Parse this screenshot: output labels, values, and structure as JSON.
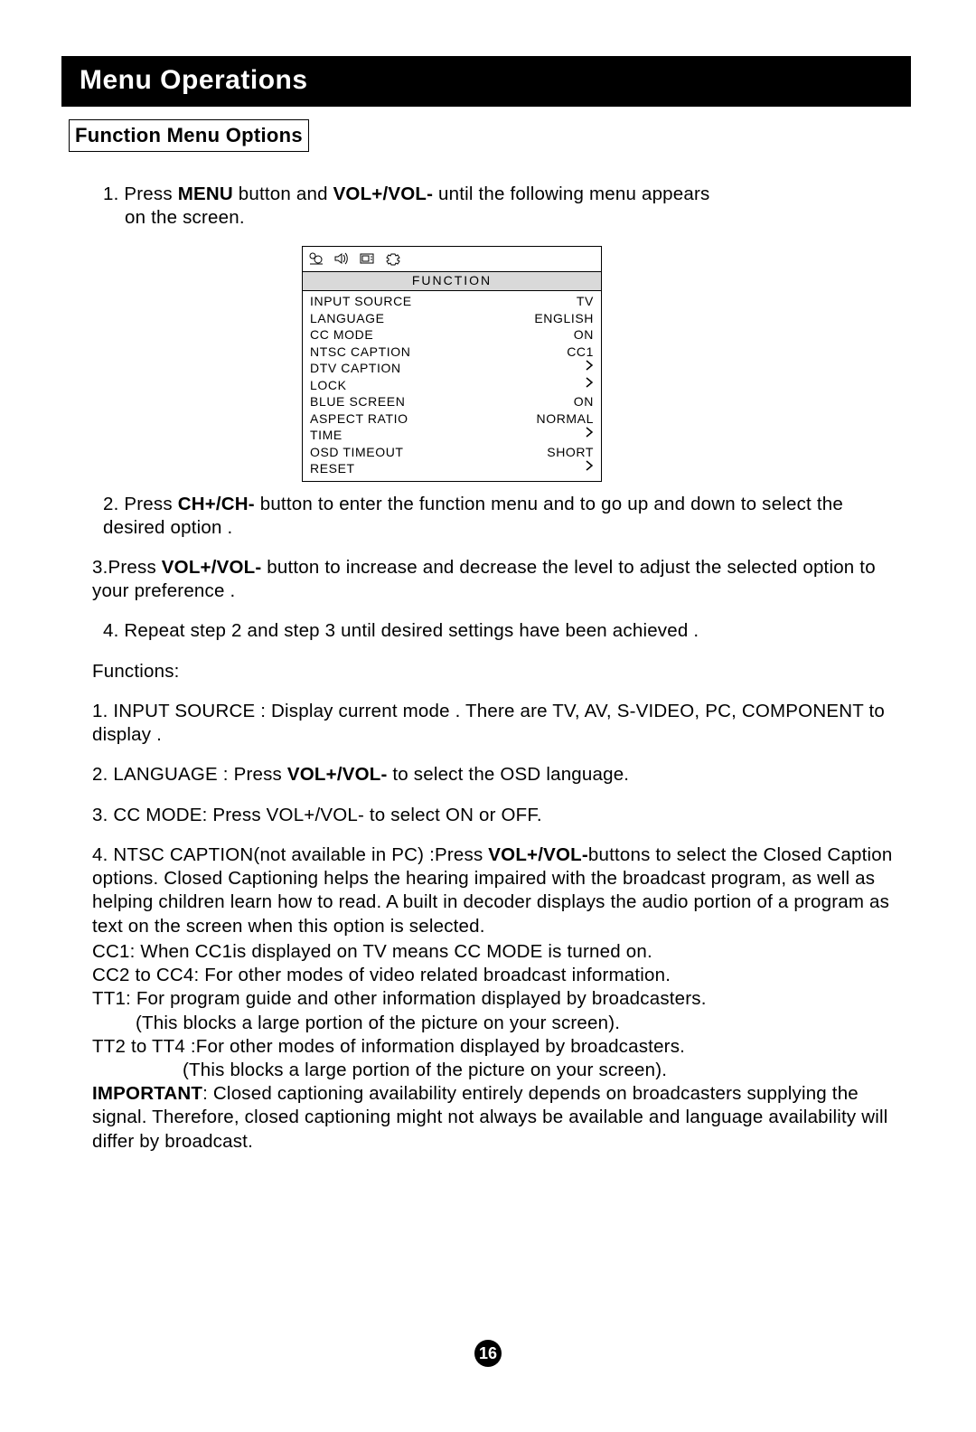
{
  "title": "Menu Operations",
  "subhead": "Function Menu Options",
  "step1_a": "1. Press ",
  "step1_b": "MENU",
  "step1_c": " button and ",
  "step1_d": "VOL+/VOL-",
  "step1_e": " until the following menu appears",
  "step1_f": "on the screen.",
  "menu": {
    "header": "FUNCTION",
    "rows": [
      {
        "label": "INPUT SOURCE",
        "value": "TV"
      },
      {
        "label": "LANGUAGE",
        "value": "ENGLISH"
      },
      {
        "label": "CC MODE",
        "value": "ON"
      },
      {
        "label": "NTSC CAPTION",
        "value": "CC1"
      },
      {
        "label": "DTV CAPTION",
        "value": "▶"
      },
      {
        "label": "LOCK",
        "value": "▶"
      },
      {
        "label": "BLUE SCREEN",
        "value": "ON"
      },
      {
        "label": "ASPECT RATIO",
        "value": "NORMAL"
      },
      {
        "label": "TIME",
        "value": "▶"
      },
      {
        "label": "OSD TIMEOUT",
        "value": "SHORT"
      },
      {
        "label": "RESET",
        "value": "▶"
      }
    ]
  },
  "step2_a": "2. Press ",
  "step2_b": "CH+/CH-",
  "step2_c": " button to enter the function menu and to go up and down to select the desired option .",
  "step3_a": "3.Press ",
  "step3_b": "VOL+/VOL-",
  "step3_c": " button to increase and decrease the level to adjust the selected option to your preference .",
  "step4": "4. Repeat step 2 and step 3 until desired settings have been achieved .",
  "functions_label": "Functions:",
  "func1": "1. INPUT SOURCE : Display current mode . There are  TV, AV, S-VIDEO, PC, COMPONENT to display .",
  "func2_a": "2. LANGUAGE : Press ",
  "func2_b": "VOL+/VOL-",
  "func2_c": " to select the OSD language.",
  "func3": "3. CC MODE: Press VOL+/VOL- to select ON or OFF.",
  "func4_a": "4. NTSC CAPTION(not available in PC) :Press ",
  "func4_b": "VOL+/VOL-",
  "func4_c": "buttons to select the Closed Caption options.  Closed Captioning helps the hearing impaired with the broadcast program, as well as helping children learn how to read. A built in decoder displays the audio portion of a program as text on the screen when this  option is selected.",
  "cc1": "CC1:  When CC1is displayed on TV means CC MODE is turned on.",
  "cc2": "CC2 to CC4: For other modes of video related broadcast information.",
  "tt1": "TT1: For program guide and other information displayed by broadcasters.",
  "tt1_b": "(This blocks a large portion of the picture on your screen).",
  "tt2": "TT2 to TT4 :For other modes of information displayed by broadcasters.",
  "tt2_b": "(This blocks a large portion of the picture on your screen).",
  "important_a": "IMPORTANT",
  "important_b": ": Closed captioning availability entirely depends on broadcasters supplying the signal.  Therefore, closed captioning might not always be available and language availability will differ by broadcast.",
  "page_number": "16"
}
